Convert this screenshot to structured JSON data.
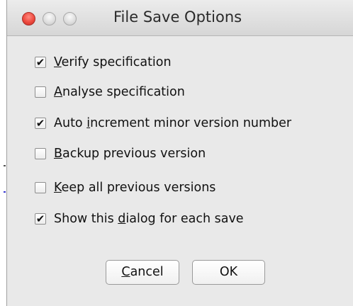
{
  "window": {
    "title": "File Save Options",
    "controls": [
      {
        "name": "close",
        "color": "#ee4a3f"
      },
      {
        "name": "minimize",
        "color": "#d8d8d8"
      },
      {
        "name": "zoom",
        "color": "#d8d8d8"
      }
    ]
  },
  "options": [
    {
      "pre": "",
      "u": "V",
      "post": "erify specification",
      "checked": true
    },
    {
      "pre": "",
      "u": "A",
      "post": "nalyse specification",
      "checked": false
    },
    {
      "pre": "Auto ",
      "u": "i",
      "post": "ncrement minor version number",
      "checked": true
    },
    {
      "pre": "",
      "u": "B",
      "post": "ackup previous version",
      "checked": false
    },
    {
      "pre": "",
      "u": "K",
      "post": "eep all previous versions",
      "checked": false
    },
    {
      "pre": "Show this ",
      "u": "d",
      "post": "ialog for each save",
      "checked": true
    }
  ],
  "buttons": {
    "cancel": {
      "pre": "",
      "u": "C",
      "post": "ancel"
    },
    "ok": "OK"
  }
}
